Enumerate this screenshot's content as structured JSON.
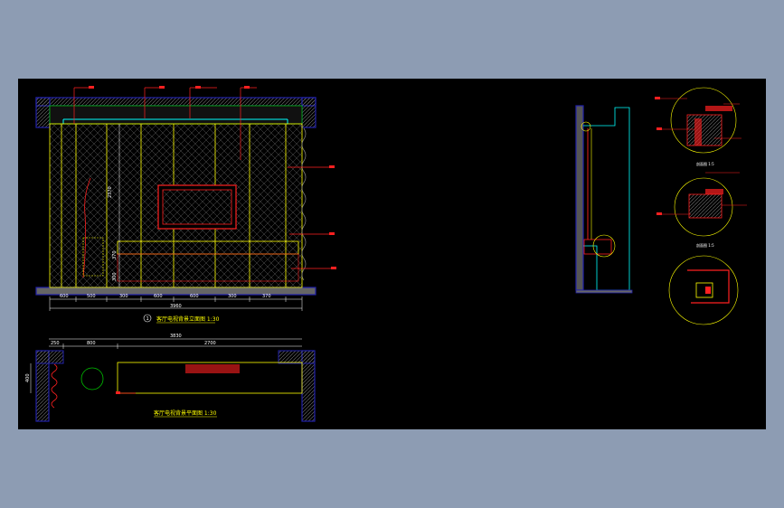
{
  "colors": {
    "background": "#8d9cb3",
    "canvas": "#000000",
    "wall": "#2222aa",
    "hatch": "#6f6f6f",
    "leader": "#ff2020",
    "panel": "#ffff00",
    "cyan": "#00ffff",
    "green": "#00c000",
    "magenta": "#c000c0",
    "white": "#ffffff"
  },
  "elevation": {
    "top_dims": [
      "600",
      "500",
      "300",
      "600",
      "600",
      "300",
      "370"
    ],
    "total_dim": "3960",
    "height_dims": [
      "2370",
      "370",
      "300"
    ],
    "caption_index": "1",
    "caption": "客厅电视背景立面图 1:30"
  },
  "plan": {
    "top_dims": [
      "250",
      "800",
      "2700"
    ],
    "total_dim": "3830",
    "side_dim": "400",
    "caption": "客厅电视背景平面图 1:30"
  },
  "details": {
    "detail_labels": [
      "剖面图 1:5",
      "剖面图 1:5"
    ]
  }
}
